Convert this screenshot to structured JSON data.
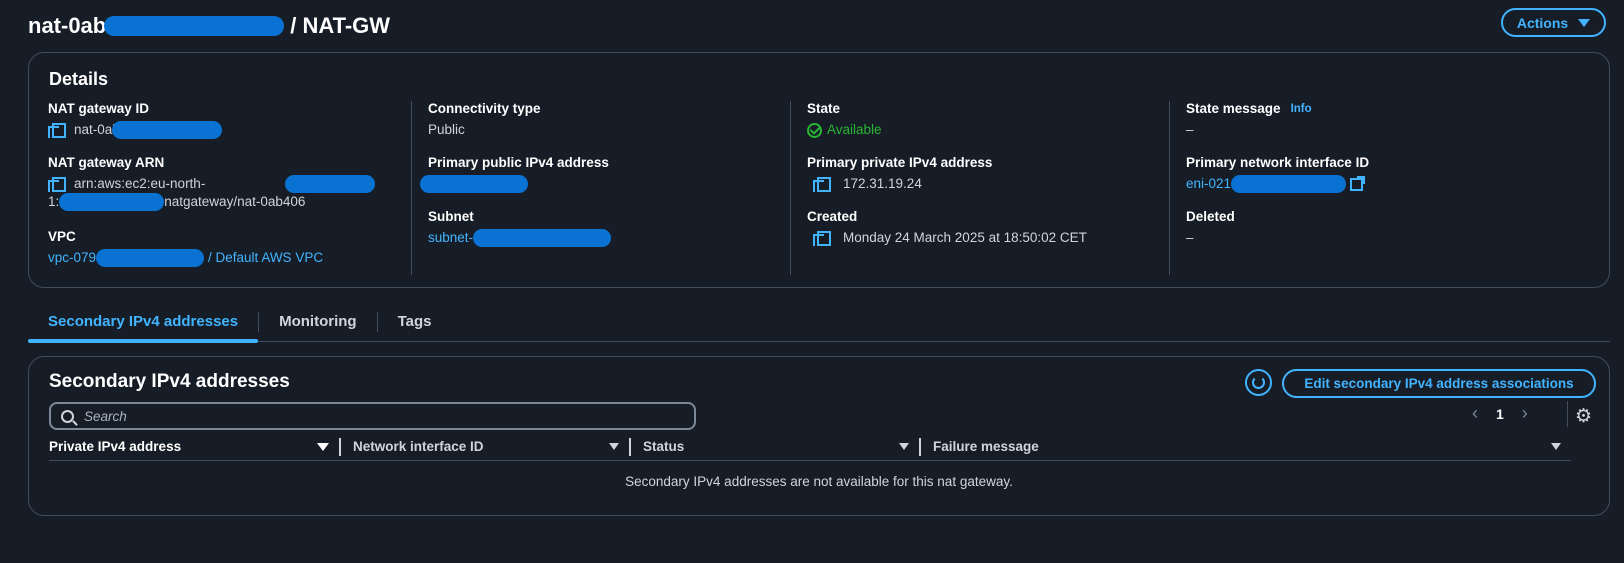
{
  "header": {
    "title_prefix": "nat-0ab",
    "title_suffix": "/ NAT-GW",
    "actions_label": "Actions"
  },
  "details": {
    "heading": "Details",
    "nat_id": {
      "label": "NAT gateway ID",
      "value": "nat-0ab"
    },
    "nat_arn": {
      "label": "NAT gateway ARN",
      "line1": "arn:aws:ec2:eu-north-",
      "line2_a": "1:",
      "line2_b": "natgateway/nat-0ab406"
    },
    "vpc": {
      "label": "VPC",
      "value_prefix": "vpc-079",
      "value_suffix": "/ Default AWS VPC"
    },
    "connectivity": {
      "label": "Connectivity type",
      "value": "Public"
    },
    "public_ip": {
      "label": "Primary public IPv4 address"
    },
    "subnet": {
      "label": "Subnet",
      "value_prefix": "subnet-"
    },
    "state": {
      "label": "State",
      "value": "Available"
    },
    "private_ip": {
      "label": "Primary private IPv4 address",
      "value": "172.31.19.24"
    },
    "created": {
      "label": "Created",
      "value": "Monday 24 March 2025 at 18:50:02 CET"
    },
    "state_message": {
      "label": "State message",
      "info": "Info",
      "value": "–"
    },
    "eni": {
      "label": "Primary network interface ID",
      "value_prefix": "eni-021"
    },
    "deleted": {
      "label": "Deleted",
      "value": "–"
    }
  },
  "tabs": [
    {
      "label": "Secondary IPv4 addresses",
      "active": true
    },
    {
      "label": "Monitoring",
      "active": false
    },
    {
      "label": "Tags",
      "active": false
    }
  ],
  "secondary": {
    "heading": "Secondary IPv4 addresses",
    "edit_label": "Edit secondary IPv4 address associations",
    "search_placeholder": "Search",
    "page": "1",
    "columns": [
      "Private IPv4 address",
      "Network interface ID",
      "Status",
      "Failure message"
    ],
    "empty_message": "Secondary IPv4 addresses are not available for this nat gateway."
  },
  "colors": {
    "accent": "#42b4ff",
    "success": "#2bb534",
    "background": "#161d26",
    "border": "#414d5c",
    "redaction": "#0972d3"
  },
  "icons": [
    "copy-icon",
    "check-circle-icon",
    "info-link",
    "external-link-icon",
    "refresh-icon",
    "search-icon",
    "chevron-left-icon",
    "chevron-right-icon",
    "gear-icon",
    "sort-icon",
    "caret-down-icon"
  ]
}
